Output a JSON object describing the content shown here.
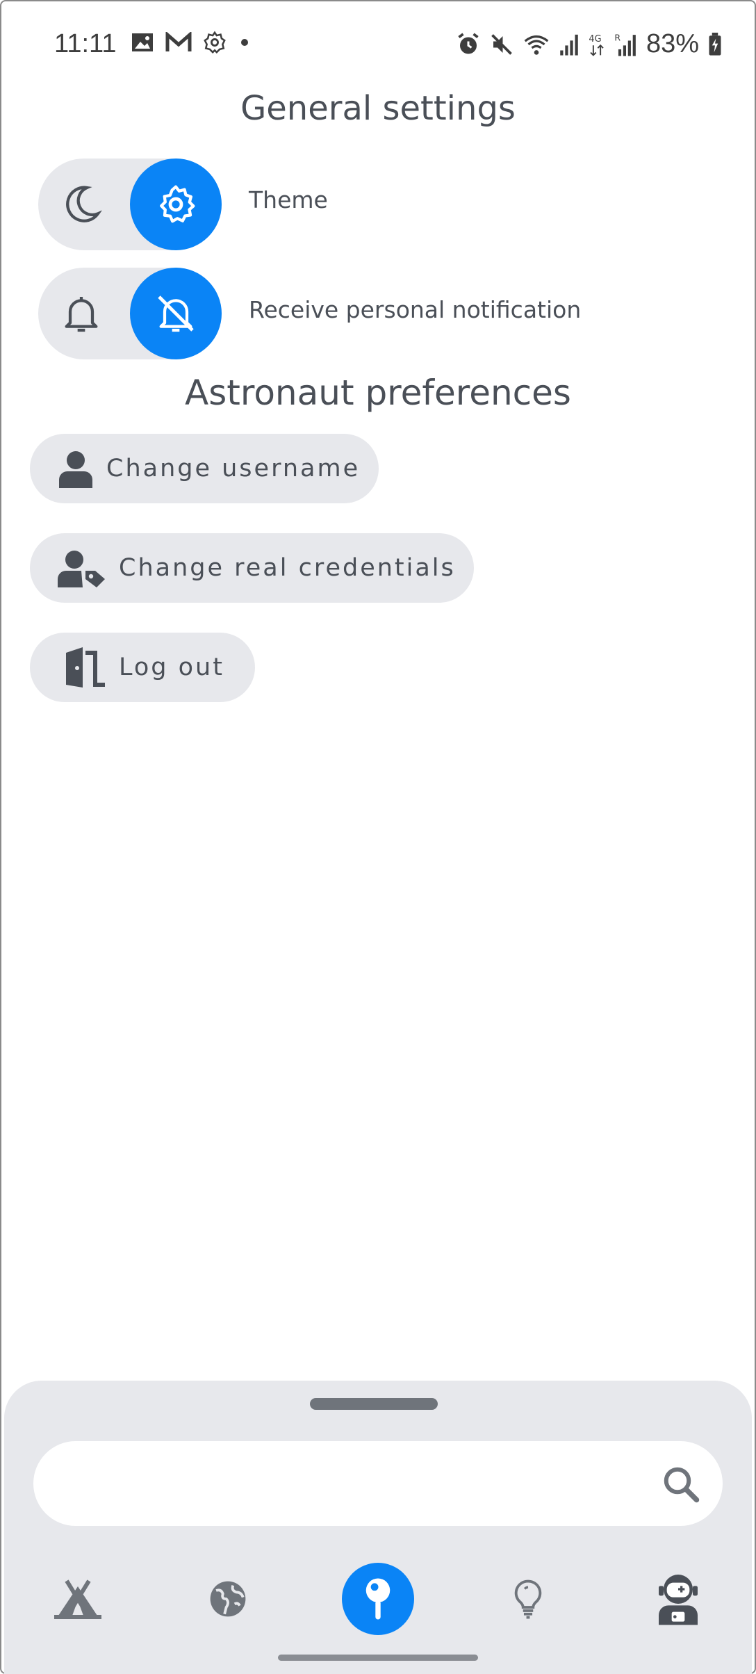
{
  "status_bar": {
    "time": "11:11",
    "battery": "83%"
  },
  "general_settings": {
    "title": "General settings",
    "theme_label": "Theme",
    "notification_label": "Receive personal notification"
  },
  "astronaut_preferences": {
    "title": "Astronaut preferences",
    "change_username": "Change username",
    "change_credentials": "Change real credentials",
    "log_out": "Log out"
  },
  "search": {
    "placeholder": ""
  },
  "bottom_nav": {
    "items": [
      "camp-icon",
      "globe-icon",
      "pin-icon",
      "lightbulb-icon",
      "astronaut-icon"
    ],
    "active_index": 2
  },
  "colors": {
    "accent": "#0a84f6",
    "pill_bg": "#e7e8ec",
    "text": "#4a4f57"
  }
}
